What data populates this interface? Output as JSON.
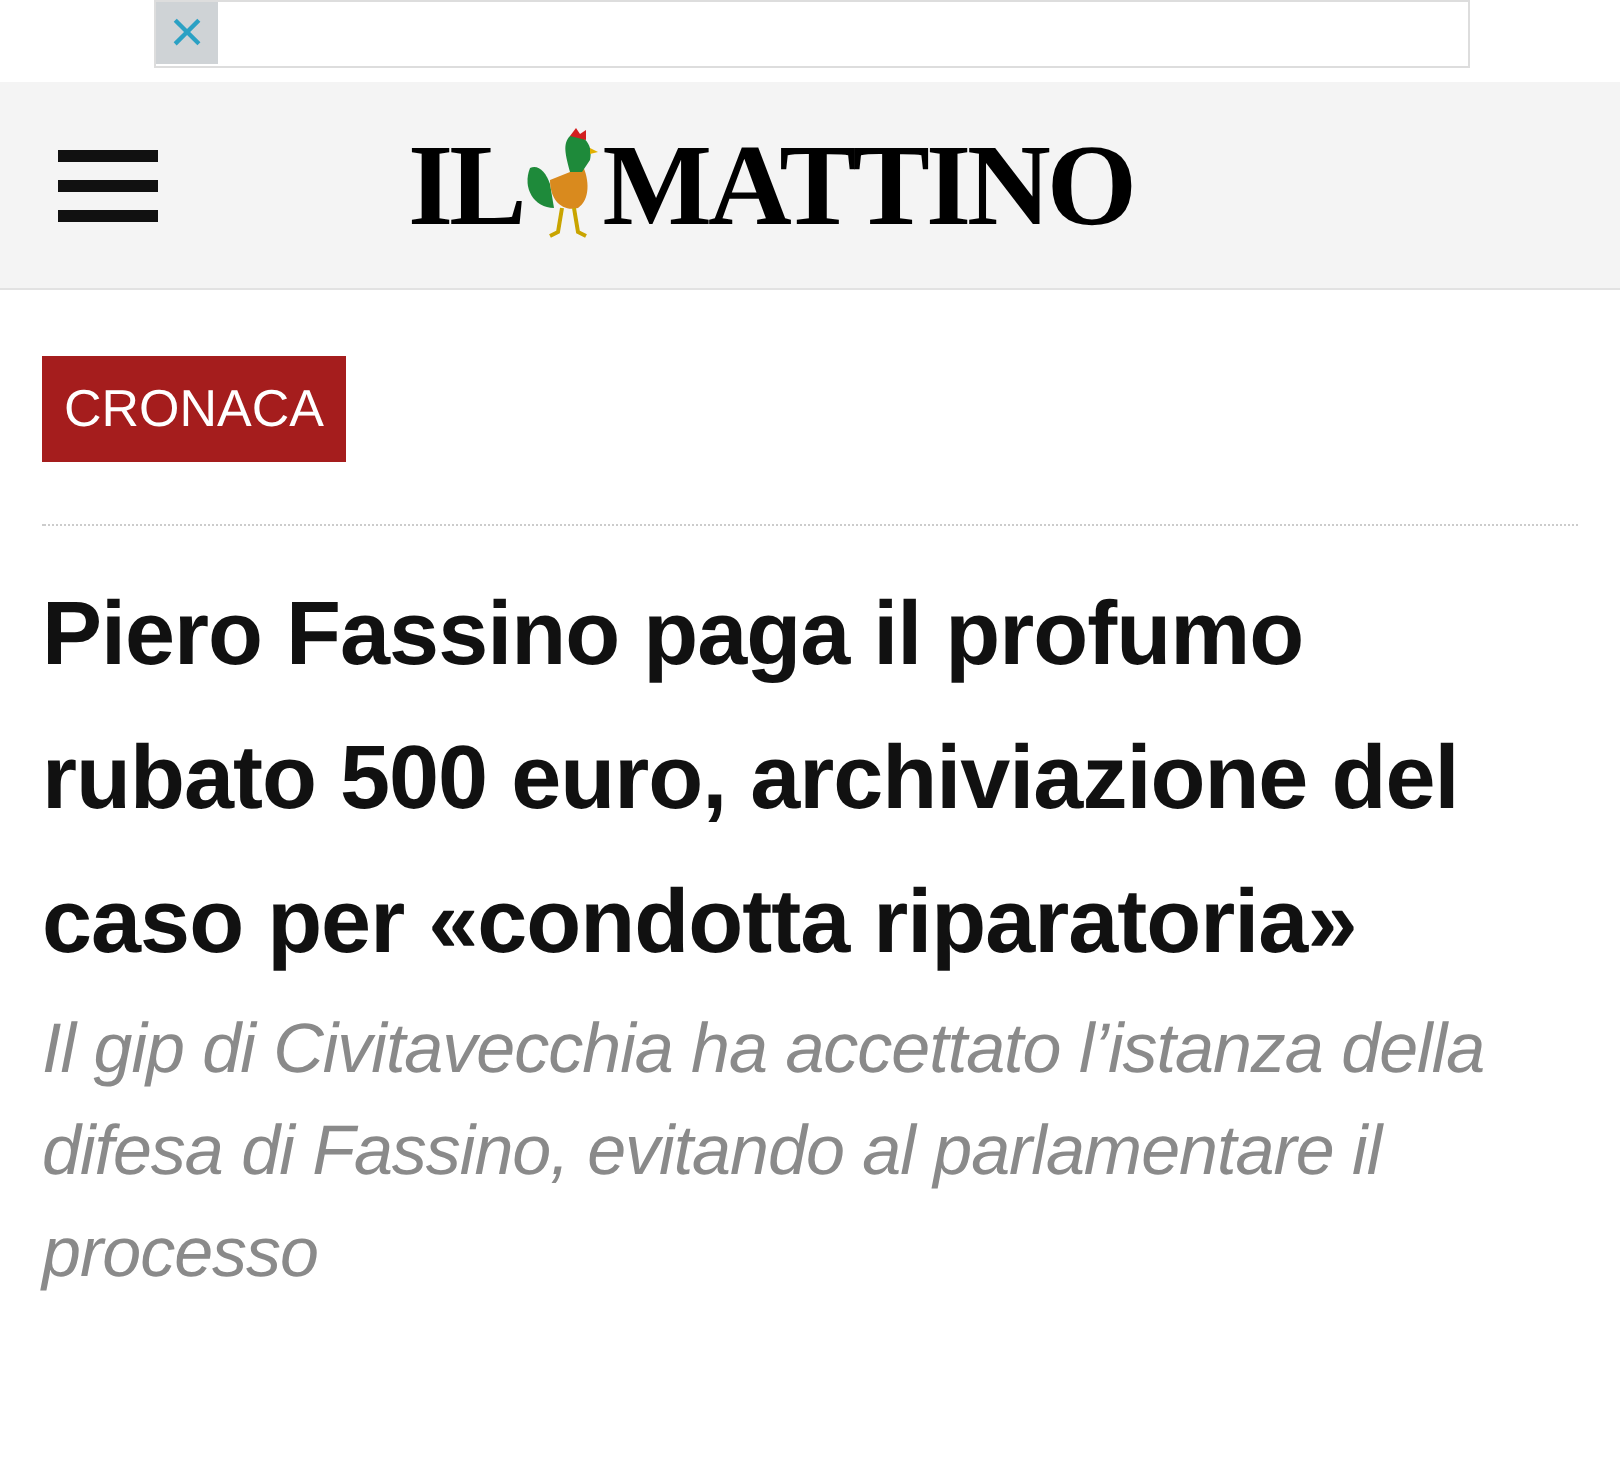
{
  "ad_banner": {
    "close": "×"
  },
  "header": {
    "logo_left": "IL",
    "logo_right": "MATTINO"
  },
  "category": "CRONACA",
  "headline": "Piero Fassino paga il profumo rubato 500 euro, archiviazione del caso per «condotta riparatoria»",
  "subtitle": "Il gip di Civitavecchia ha accettato l’istanza della difesa di Fassino, evitando al parlamentare il processo"
}
